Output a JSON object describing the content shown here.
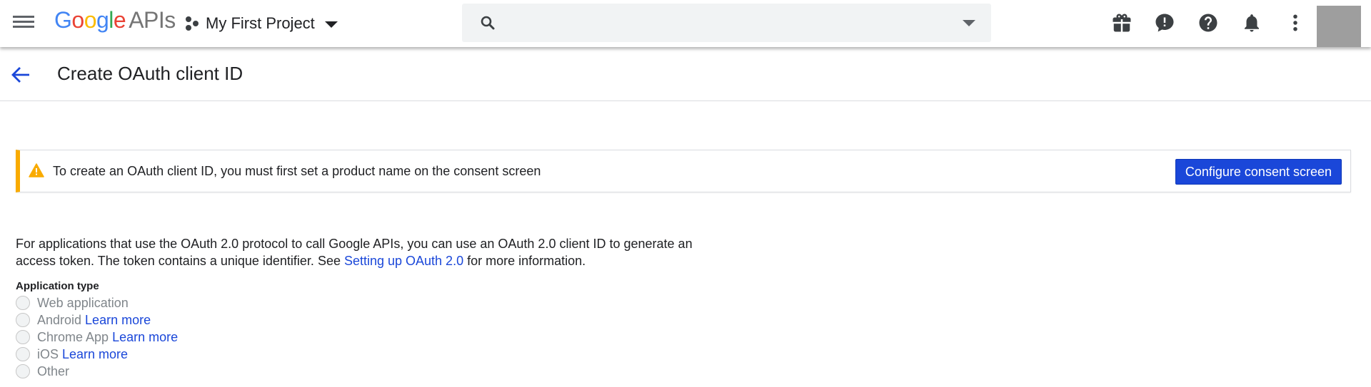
{
  "topbar": {
    "logo": {
      "g1": "G",
      "o1": "o",
      "o2": "o",
      "g2": "g",
      "l": "l",
      "e": "e",
      "apis": "APIs"
    },
    "project_name": "My First Project",
    "search": {
      "placeholder": "",
      "value": ""
    },
    "icons": [
      "gift-icon",
      "feedback-icon",
      "help-icon",
      "notifications-icon",
      "more-vert-icon"
    ]
  },
  "page": {
    "title": "Create OAuth client ID"
  },
  "alert": {
    "message": "To create an OAuth client ID, you must first set a product name on the consent screen",
    "button_label": "Configure consent screen"
  },
  "description": {
    "text_before": "For applications that use the OAuth 2.0 protocol to call Google APIs, you can use an OAuth 2.0 client ID to generate an access token. The token contains a unique identifier. See ",
    "link_text": "Setting up OAuth 2.0",
    "text_after": " for more information."
  },
  "application_type": {
    "label": "Application type",
    "options": [
      {
        "label": "Web application",
        "link": ""
      },
      {
        "label": "Android",
        "link": "Learn more"
      },
      {
        "label": "Chrome App",
        "link": "Learn more"
      },
      {
        "label": "iOS",
        "link": "Learn more"
      },
      {
        "label": "Other",
        "link": ""
      }
    ]
  },
  "colors": {
    "link_blue": "#1a47d9",
    "warning": "#f9ab00",
    "primary_button": "#1a47d9"
  }
}
